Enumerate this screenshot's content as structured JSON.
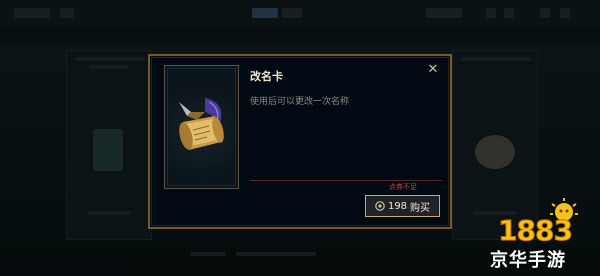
{
  "background": {
    "top_tabs": [
      "",
      "",
      ""
    ],
    "accent": "#3d5c7a"
  },
  "dialog": {
    "title": "改名卡",
    "description": "使用后可以更改一次名称",
    "close_symbol": "✕",
    "warning": "点券不足",
    "price": "198",
    "buy_label": "购买",
    "currency_icon": "rp-coin-icon",
    "item_icon": "scroll-quill-icon",
    "border_color": "#785a28",
    "warning_color": "#c8443c"
  },
  "watermark": {
    "number": "1883",
    "text": "京华手游"
  }
}
